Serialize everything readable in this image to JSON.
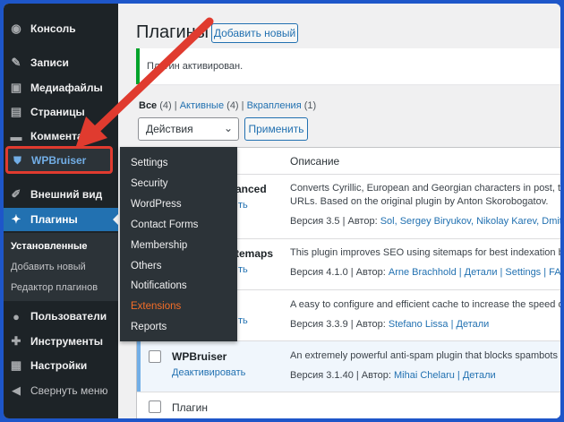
{
  "sidebar": {
    "items": [
      {
        "label": "Консоль",
        "icon": "dashboard-icon",
        "glyph": "◉"
      },
      {
        "label": "Записи",
        "icon": "pin-icon",
        "glyph": "✎"
      },
      {
        "label": "Медиафайлы",
        "icon": "media-icon",
        "glyph": "▣"
      },
      {
        "label": "Страницы",
        "icon": "pages-icon",
        "glyph": "▤"
      },
      {
        "label": "Комментарии",
        "icon": "comments-icon",
        "glyph": "▬"
      },
      {
        "label": "Внешний вид",
        "icon": "appearance-icon",
        "glyph": "✐"
      },
      {
        "label": "Плагины",
        "icon": "plugins-icon",
        "glyph": "✦"
      },
      {
        "label": "Пользователи",
        "icon": "users-icon",
        "glyph": "●"
      },
      {
        "label": "Инструменты",
        "icon": "tools-icon",
        "glyph": "✚"
      },
      {
        "label": "Настройки",
        "icon": "settings-icon",
        "glyph": "▦"
      },
      {
        "label": "Свернуть меню",
        "icon": "collapse-icon",
        "glyph": "◀"
      }
    ],
    "wpbruiser": {
      "label": "WPBruiser",
      "glyph": "⛊"
    },
    "plugins_sub": {
      "installed": "Установленные",
      "add_new": "Добавить новый",
      "editor": "Редактор плагинов"
    }
  },
  "flyout": {
    "items": [
      "Settings",
      "Security",
      "WordPress",
      "Contact Forms",
      "Membership",
      "Others",
      "Notifications",
      "Extensions",
      "Reports"
    ]
  },
  "header": {
    "title": "Плагины",
    "add_new": "Добавить новый"
  },
  "notice": "Плагин активирован.",
  "filters": {
    "all": "Все",
    "all_count": "(4)",
    "active": "Активные",
    "active_count": "(4)",
    "dropins": "Вкрапления",
    "dropins_count": "(1)",
    "sep": "|"
  },
  "bulk": {
    "select": "Действия",
    "apply": "Применить"
  },
  "table": {
    "col_plugin": "Плагин",
    "col_description": "Описание",
    "rows": [
      {
        "name": "anced",
        "desc1": "Converts Cyrillic, European and Georgian characters in post, term s",
        "desc2": "URLs. Based on the original plugin by Anton Skorobogatov.",
        "version": "Версия 3.5 | Автор:",
        "authors": "Sol, Sergey Biryukov, Nikolay Karev, Dmitri Go",
        "action": "ть"
      },
      {
        "name": "temaps",
        "desc1": "This plugin improves SEO using sitemaps for best indexation by se",
        "version": "Версия 4.1.0 | Автор:",
        "authors": "Arne Brachhold | Детали | Settings | FAQ | Su",
        "action": "ть"
      },
      {
        "name": "",
        "desc1": "A easy to configure and efficient cache to increase the speed of yo",
        "version": "Версия 3.3.9 | Автор:",
        "authors": "Stefano Lissa | Детали",
        "action": "ть"
      },
      {
        "name": "WPBruiser",
        "desc1": "An extremely powerful anti-spam plugin that blocks spambots with",
        "version": "Версия 3.1.40 | Автор:",
        "authors": "Mihai Chelaru | Детали",
        "action": "Деактивировать"
      }
    ],
    "footer_col_plugin": "Плагин"
  },
  "colors": {
    "sidebar_bg": "#1d2327",
    "accent": "#2271b1",
    "highlight": "#e03b2f",
    "frame": "#1e56c9"
  }
}
